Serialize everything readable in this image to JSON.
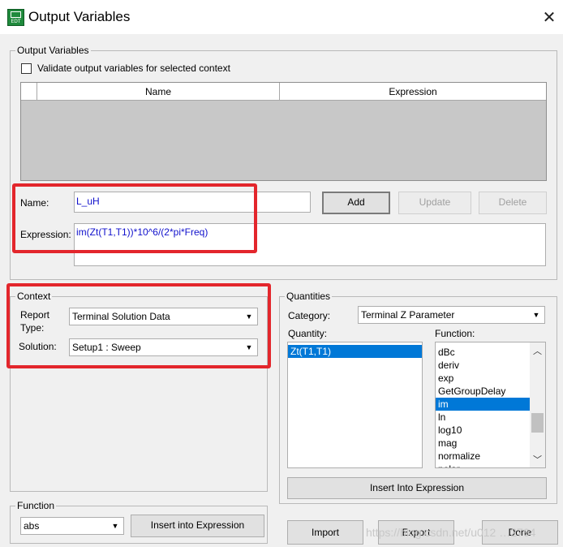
{
  "window": {
    "title": "Output Variables",
    "icon_name": "edt-app-icon",
    "icon_label": "EDT",
    "close_glyph": "✕"
  },
  "output_variables": {
    "group_label": "Output Variables",
    "validate_label": "Validate output variables for selected context",
    "validate_checked": false,
    "table_headers": [
      "Name",
      "Expression"
    ],
    "rows": []
  },
  "editor": {
    "name_label": "Name:",
    "name_value": "L_uH",
    "expression_label": "Expression:",
    "expression_value": "im(Zt(T1,T1))*10^6/(2*pi*Freq)",
    "add_label": "Add",
    "update_label": "Update",
    "delete_label": "Delete"
  },
  "context": {
    "group_label": "Context",
    "report_type_label": "Report Type:",
    "report_type_line1": "Report",
    "report_type_line2": "Type:",
    "report_type_value": "Terminal Solution Data",
    "solution_label": "Solution:",
    "solution_value": "Setup1 : Sweep"
  },
  "quantities": {
    "group_label": "Quantities",
    "category_label": "Category:",
    "category_value": "Terminal Z Parameter",
    "quantity_label": "Quantity:",
    "quantity_items": [
      "Zt(T1,T1)"
    ],
    "quantity_selected": "Zt(T1,T1)",
    "function_label": "Function:",
    "function_items": [
      "dBc",
      "deriv",
      "exp",
      "GetGroupDelay",
      "im",
      "ln",
      "log10",
      "mag",
      "normalize",
      "polar"
    ],
    "function_selected": "im",
    "insert_label": "Insert Into Expression"
  },
  "function_group": {
    "group_label": "Function",
    "value": "abs",
    "insert_label": "Insert into Expression"
  },
  "footer": {
    "import_label": "Import",
    "export_label": "Export",
    "done_label": "Done"
  },
  "watermark": "https://blog.csdn.net/u012 …2764",
  "colors": {
    "highlight_box": "#e3262c",
    "selection": "#0078d7",
    "input_text": "#1010cc"
  }
}
